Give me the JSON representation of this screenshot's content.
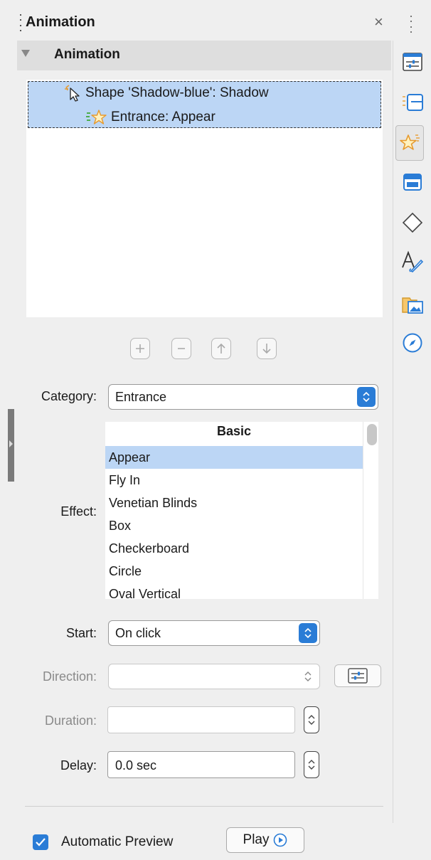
{
  "panel": {
    "title": "Animation",
    "close_glyph": "×"
  },
  "section": {
    "title": "Animation"
  },
  "animation_list": [
    {
      "label": "Shape 'Shadow-blue': Shadow",
      "icon": "cursor-click-icon"
    },
    {
      "label": "Entrance: Appear",
      "icon": "star-entrance-icon"
    }
  ],
  "list_buttons": [
    "add-effect-icon",
    "remove-effect-icon",
    "move-up-icon",
    "move-down-icon"
  ],
  "fields": {
    "category": {
      "label": "Category:",
      "value": "Entrance"
    },
    "effect": {
      "label": "Effect:",
      "group_header": "Basic",
      "items": [
        "Appear",
        "Fly In",
        "Venetian Blinds",
        "Box",
        "Checkerboard",
        "Circle",
        "Oval Vertical"
      ],
      "selected": "Appear"
    },
    "start": {
      "label": "Start:",
      "value": "On click"
    },
    "direction": {
      "label": "Direction:",
      "value": ""
    },
    "duration": {
      "label": "Duration:",
      "value": ""
    },
    "delay": {
      "label": "Delay:",
      "value": "0.0 sec"
    }
  },
  "footer": {
    "automatic_preview_label": "Automatic Preview",
    "automatic_preview_checked": true,
    "play_label": "Play"
  },
  "sidebar_tabs": [
    "properties-icon",
    "slide-transition-icon",
    "animation-icon",
    "master-slides-icon",
    "shapes-icon",
    "styles-icon",
    "gallery-icon",
    "navigator-icon"
  ],
  "colors": {
    "accent": "#2a7cd6",
    "selection": "#bcd6f5",
    "background": "#efefef"
  }
}
